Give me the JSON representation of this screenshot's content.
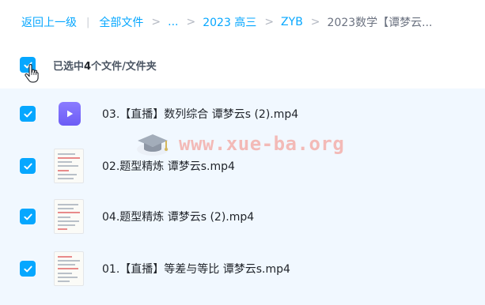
{
  "breadcrumb": {
    "back": "返回上一级",
    "all_files": "全部文件",
    "ellipsis": "...",
    "level1": "2023 高三",
    "level2": "ZYB",
    "current": "2023数学【谭梦云..."
  },
  "selection": {
    "prefix": "已选中",
    "count": "4",
    "suffix": "个文件/文件夹"
  },
  "watermark": {
    "text": "www.xue-ba.org"
  },
  "files": [
    {
      "name": "03.【直播】数列综合 谭梦云s (2).mp4",
      "thumb": "video-icon"
    },
    {
      "name": "02.题型精炼 谭梦云s.mp4",
      "thumb": "document-thumbnail"
    },
    {
      "name": "04.题型精炼 谭梦云s (2).mp4",
      "thumb": "document-thumbnail"
    },
    {
      "name": "01.【直播】等差与等比 谭梦云s.mp4",
      "thumb": "document-thumbnail"
    }
  ],
  "colors": {
    "accent": "#06a7ff",
    "list_bg": "#f1f8ff",
    "video_icon": "#7b6cf8"
  }
}
